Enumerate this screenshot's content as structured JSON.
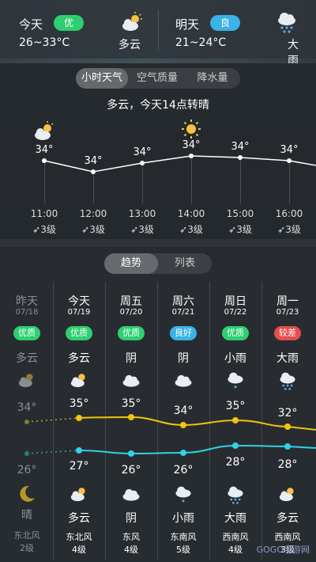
{
  "top": {
    "today": {
      "label": "今天",
      "aqi": "优",
      "aqi_color": "#2ecf70",
      "temp": "26~33°C",
      "cond": "多云",
      "icon": "partly-cloudy-icon"
    },
    "tomorrow": {
      "label": "明天",
      "aqi": "良",
      "aqi_color": "#3ab3e6",
      "temp": "21~24°C",
      "cond": "大雨",
      "icon": "heavy-rain-icon"
    }
  },
  "hourly": {
    "tabs": [
      "小时天气",
      "空气质量",
      "降水量"
    ],
    "active_tab": 0,
    "summary": "多云，今天14点转晴",
    "items": [
      {
        "time": "11:00",
        "temp": "34°",
        "wind": "3级",
        "icon": "partly-cloudy-icon"
      },
      {
        "time": "12:00",
        "temp": "34°",
        "wind": "3级",
        "icon": ""
      },
      {
        "time": "13:00",
        "temp": "34°",
        "wind": "3级",
        "icon": ""
      },
      {
        "time": "14:00",
        "temp": "34°",
        "wind": "3级",
        "icon": "sun-icon"
      },
      {
        "time": "15:00",
        "temp": "34°",
        "wind": "3级",
        "icon": ""
      },
      {
        "time": "16:00",
        "temp": "34°",
        "wind": "3级",
        "icon": ""
      }
    ]
  },
  "daily": {
    "tabs": [
      "趋势",
      "列表"
    ],
    "active_tab": 0,
    "days": [
      {
        "name": "昨天",
        "date": "07/18",
        "aqi": "优质",
        "aqi_color": "#2ecf70",
        "day_cond": "多云",
        "day_icon": "partly-cloudy-icon",
        "high": "34°",
        "low": "26°",
        "night_icon": "moon-icon",
        "night_cond": "晴",
        "wind_dir": "东北风",
        "wind_level": "2级",
        "past": true
      },
      {
        "name": "今天",
        "date": "07/19",
        "aqi": "优质",
        "aqi_color": "#2ecf70",
        "day_cond": "多云",
        "day_icon": "partly-cloudy-icon",
        "high": "35°",
        "low": "27°",
        "night_icon": "partly-cloudy-icon",
        "night_cond": "多云",
        "wind_dir": "东北风",
        "wind_level": "4级",
        "past": false
      },
      {
        "name": "周五",
        "date": "07/20",
        "aqi": "优质",
        "aqi_color": "#2ecf70",
        "day_cond": "阴",
        "day_icon": "cloud-icon",
        "high": "35°",
        "low": "26°",
        "night_icon": "cloud-icon",
        "night_cond": "阴",
        "wind_dir": "东风",
        "wind_level": "4级",
        "past": false
      },
      {
        "name": "周六",
        "date": "07/21",
        "aqi": "良好",
        "aqi_color": "#3ab3e6",
        "day_cond": "阴",
        "day_icon": "cloud-icon",
        "high": "34°",
        "low": "26°",
        "night_icon": "light-rain-icon",
        "night_cond": "小雨",
        "wind_dir": "东南风",
        "wind_level": "5级",
        "past": false
      },
      {
        "name": "周日",
        "date": "07/22",
        "aqi": "优质",
        "aqi_color": "#2ecf70",
        "day_cond": "小雨",
        "day_icon": "light-rain-icon",
        "high": "35°",
        "low": "28°",
        "night_icon": "heavy-rain-icon",
        "night_cond": "大雨",
        "wind_dir": "西南风",
        "wind_level": "4级",
        "past": false
      },
      {
        "name": "周一",
        "date": "07/23",
        "aqi": "较差",
        "aqi_color": "#e84c4c",
        "day_cond": "大雨",
        "day_icon": "heavy-rain-icon",
        "high": "32°",
        "low": "28°",
        "night_icon": "partly-cloudy-icon",
        "night_cond": "多云",
        "wind_dir": "西南风",
        "wind_level": "3级",
        "past": false
      }
    ]
  },
  "colors": {
    "high_line": "#f1c40f",
    "low_line": "#2fd3e6"
  },
  "watermark": "GOGO手游网"
}
